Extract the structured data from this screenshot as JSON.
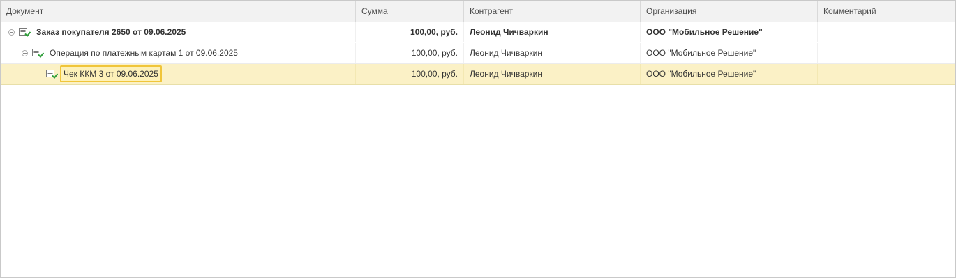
{
  "columns": {
    "document": "Документ",
    "sum": "Сумма",
    "counterparty": "Контрагент",
    "organization": "Организация",
    "comment": "Комментарий"
  },
  "rows": [
    {
      "document": "Заказ покупателя 2650 от 09.06.2025",
      "sum": "100,00, руб.",
      "counterparty": "Леонид Чичваркин",
      "organization": "ООО \"Мобильное Решение\"",
      "comment": "",
      "level": 0,
      "expanded": true,
      "bold": true
    },
    {
      "document": "Операция по платежным картам 1 от 09.06.2025",
      "sum": "100,00, руб.",
      "counterparty": "Леонид Чичваркин",
      "organization": "ООО \"Мобильное Решение\"",
      "comment": "",
      "level": 1,
      "expanded": true,
      "bold": false
    },
    {
      "document": "Чек ККМ 3 от 09.06.2025",
      "sum": "100,00, руб.",
      "counterparty": "Леонид Чичваркин",
      "organization": "ООО \"Мобильное Решение\"",
      "comment": "",
      "level": 2,
      "selected": true,
      "bold": false
    }
  ],
  "icons": {
    "tree_toggle": "collapse-icon",
    "document": "posted-document-icon"
  },
  "colors": {
    "selected_row": "#fbf1c6",
    "focus_border": "#f0c53a",
    "icon_green": "#2e9e3a"
  }
}
